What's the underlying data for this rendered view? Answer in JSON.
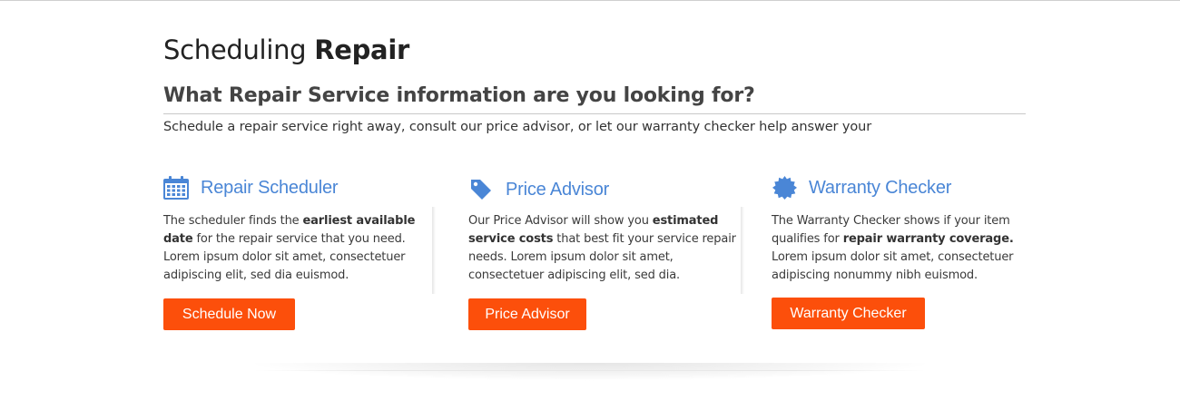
{
  "header": {
    "title_prefix": "Scheduling",
    "title_bold": "Repair",
    "subtitle": "What Repair Service information are you looking for?",
    "intro": "Schedule a repair service right away, consult our price advisor, or let our warranty checker help answer your"
  },
  "colors": {
    "accent_blue": "#4a86d6",
    "button_orange": "#fc4f0b"
  },
  "columns": [
    {
      "icon": "calendar-icon",
      "heading": "Repair Scheduler",
      "text_before": "The scheduler finds the ",
      "text_bold": "earliest available date",
      "text_after": " for the repair service that you need. Lorem ipsum dolor sit amet, consectetuer adipiscing elit, sed dia euismod.",
      "button": "Schedule Now"
    },
    {
      "icon": "price-tag-icon",
      "heading": "Price Advisor",
      "text_before": "Our Price Advisor will show you ",
      "text_bold": "estimated service costs",
      "text_after": " that best fit your service repair needs. Lorem ipsum dolor sit amet, consectetuer adipiscing elit, sed dia.",
      "button": "Price Advisor"
    },
    {
      "icon": "badge-seal-icon",
      "heading": "Warranty Checker",
      "text_before": "The Warranty Checker shows if your item qualifies for ",
      "text_bold": "repair warranty coverage.",
      "text_after": " Lorem ipsum dolor sit amet, consectetuer adipiscing nonummy nibh euismod.",
      "button": "Warranty Checker"
    }
  ]
}
